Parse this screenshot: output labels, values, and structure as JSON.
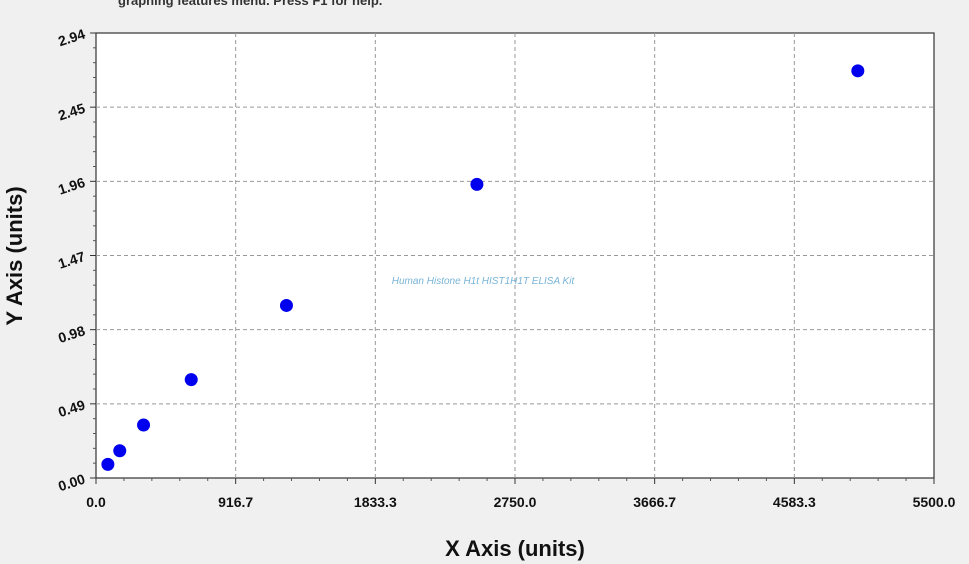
{
  "header": {
    "clipped_text": "graphing features menu. Press F1 for help."
  },
  "watermark": "Human Histone H1t HIST1H1T ELISA Kit",
  "colors": {
    "background": "#f0f0f0",
    "plot_bg": "#ffffff",
    "point": "#0000ee",
    "grid": "#999999"
  },
  "chart_data": {
    "type": "scatter",
    "title": "",
    "xlabel": "X Axis (units)",
    "ylabel": "Y Axis (units)",
    "xlim": [
      0,
      5500
    ],
    "ylim": [
      0,
      2.94
    ],
    "x_ticks": [
      "0.0",
      "916.7",
      "1833.3",
      "2750.0",
      "3666.7",
      "4583.3",
      "5500.0"
    ],
    "y_ticks": [
      "0.00",
      "0.49",
      "0.98",
      "1.47",
      "1.96",
      "2.45",
      "2.94"
    ],
    "grid": true,
    "series": [
      {
        "points": [
          {
            "x": 78,
            "y": 0.09
          },
          {
            "x": 156,
            "y": 0.18
          },
          {
            "x": 312,
            "y": 0.35
          },
          {
            "x": 625,
            "y": 0.65
          },
          {
            "x": 1250,
            "y": 1.14
          },
          {
            "x": 2500,
            "y": 1.94
          },
          {
            "x": 5000,
            "y": 2.69
          }
        ]
      }
    ]
  }
}
